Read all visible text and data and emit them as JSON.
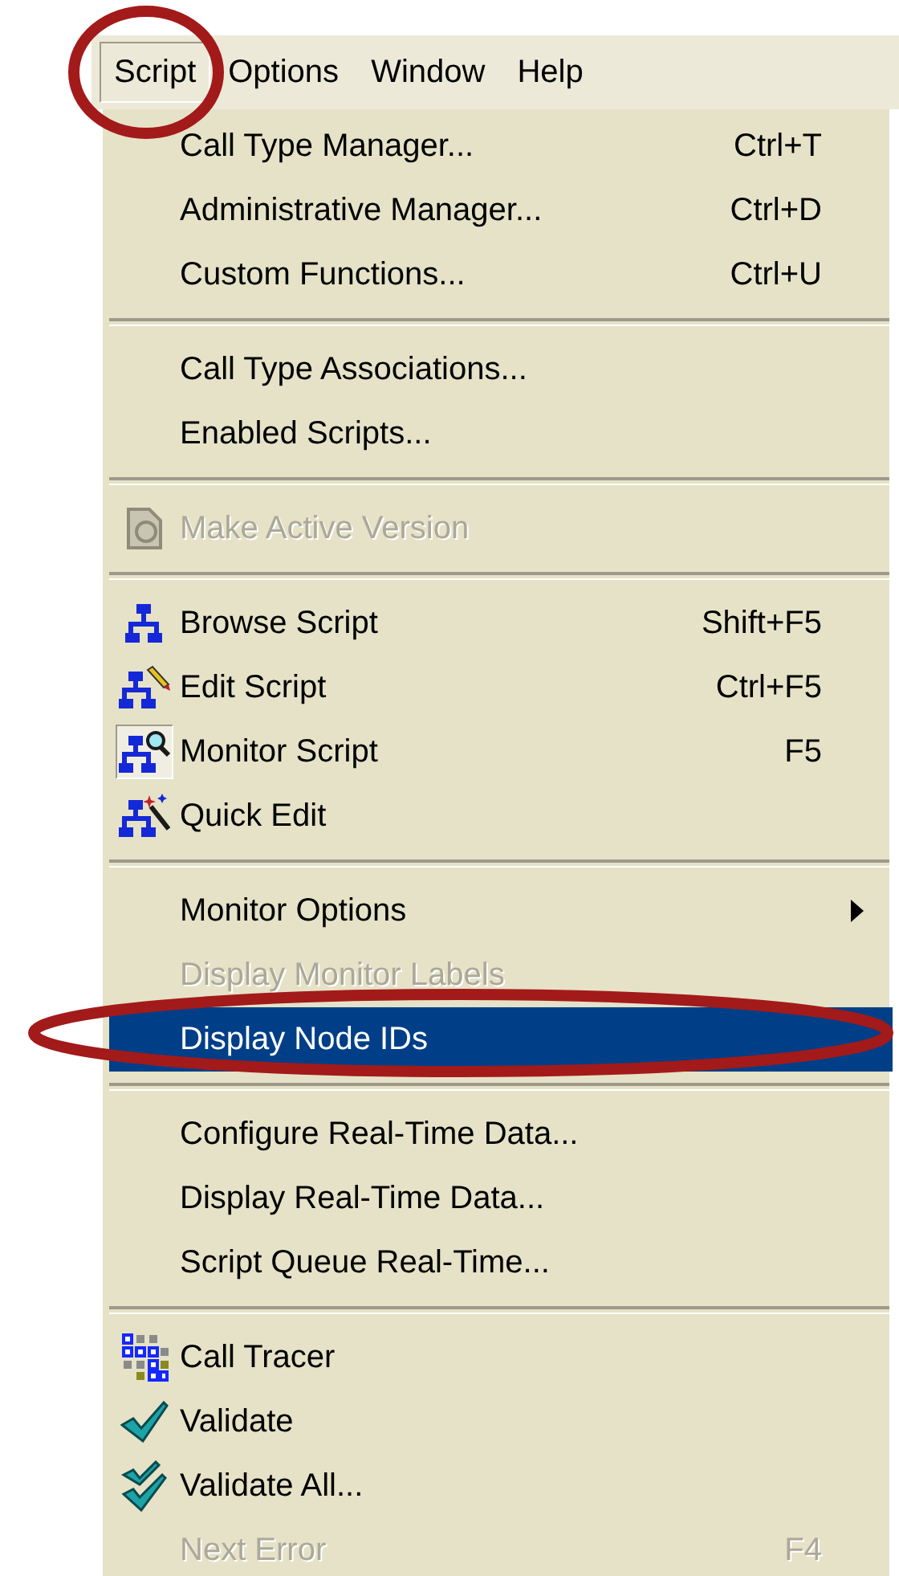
{
  "menubar": [
    {
      "label": "Script",
      "selected": true
    },
    {
      "label": "Options",
      "selected": false
    },
    {
      "label": "Window",
      "selected": false
    },
    {
      "label": "Help",
      "selected": false
    }
  ],
  "menu": {
    "items": [
      {
        "kind": "item",
        "label": "Call Type Manager...",
        "shortcut": "Ctrl+T",
        "disabled": false,
        "selected": false,
        "checked": false
      },
      {
        "kind": "item",
        "label": "Administrative Manager...",
        "shortcut": "Ctrl+D",
        "disabled": false,
        "selected": false,
        "checked": false
      },
      {
        "kind": "item",
        "label": "Custom Functions...",
        "shortcut": "Ctrl+U",
        "disabled": false,
        "selected": false,
        "checked": false
      },
      {
        "kind": "separator"
      },
      {
        "kind": "item",
        "label": "Call Type Associations...",
        "disabled": false,
        "selected": false,
        "checked": false
      },
      {
        "kind": "item",
        "label": "Enabled Scripts...",
        "disabled": false,
        "selected": false,
        "checked": false
      },
      {
        "kind": "separator"
      },
      {
        "kind": "item",
        "label": "Make Active Version",
        "disabled": true,
        "selected": false,
        "checked": false
      },
      {
        "kind": "separator"
      },
      {
        "kind": "item",
        "label": "Browse Script",
        "shortcut": "Shift+F5",
        "disabled": false,
        "selected": false,
        "checked": false
      },
      {
        "kind": "item",
        "label": "Edit Script",
        "shortcut": "Ctrl+F5",
        "disabled": false,
        "selected": false,
        "checked": false
      },
      {
        "kind": "item",
        "label": "Monitor Script",
        "shortcut": "F5",
        "disabled": false,
        "selected": false,
        "checked": true
      },
      {
        "kind": "item",
        "label": "Quick Edit",
        "disabled": false,
        "selected": false,
        "checked": false
      },
      {
        "kind": "separator"
      },
      {
        "kind": "item",
        "label": "Monitor Options",
        "submenu": true,
        "disabled": false,
        "selected": false,
        "checked": false
      },
      {
        "kind": "item",
        "label": "Display Monitor Labels",
        "disabled": true,
        "selected": false,
        "checked": false
      },
      {
        "kind": "item",
        "label": "Display Node IDs",
        "disabled": false,
        "selected": true,
        "checked": false
      },
      {
        "kind": "separator"
      },
      {
        "kind": "item",
        "label": "Configure Real-Time Data...",
        "disabled": false,
        "selected": false,
        "checked": false
      },
      {
        "kind": "item",
        "label": "Display Real-Time Data...",
        "disabled": false,
        "selected": false,
        "checked": false
      },
      {
        "kind": "item",
        "label": "Script Queue Real-Time...",
        "disabled": false,
        "selected": false,
        "checked": false
      },
      {
        "kind": "separator"
      },
      {
        "kind": "item",
        "label": "Call Tracer",
        "disabled": false,
        "selected": false,
        "checked": false
      },
      {
        "kind": "item",
        "label": "Validate",
        "disabled": false,
        "selected": false,
        "checked": false
      },
      {
        "kind": "item",
        "label": "Validate All...",
        "disabled": false,
        "selected": false,
        "checked": false
      },
      {
        "kind": "item",
        "label": "Next Error",
        "shortcut": "F4",
        "disabled": true,
        "selected": false,
        "checked": false
      }
    ]
  },
  "annotations": [
    {
      "kind": "ellipse",
      "color": "#a31a1a"
    },
    {
      "kind": "ellipse",
      "color": "#a31a1a"
    }
  ]
}
